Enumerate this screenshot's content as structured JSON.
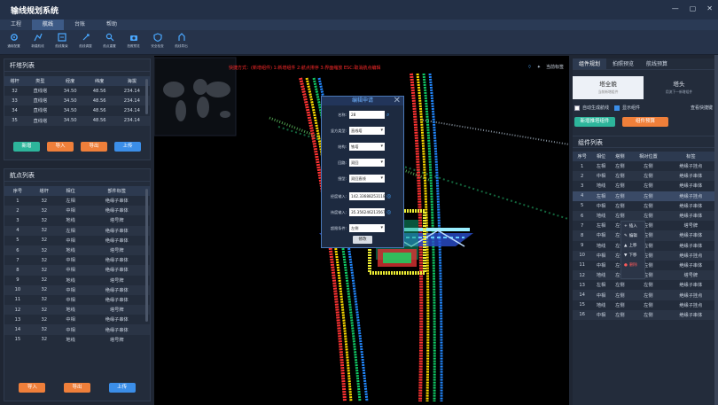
{
  "app": {
    "title": "输线规划系统"
  },
  "menu": [
    "工程",
    "航线",
    "台账",
    "帮助"
  ],
  "toolbar": [
    "通用配置",
    "新建航线",
    "航线集束",
    "航线调整",
    "航点重置",
    "拍照预览",
    "安全检查",
    "航线导出"
  ],
  "pole_panel": {
    "title": "杆塔列表",
    "columns": [
      "塔杆",
      "类型",
      "经度",
      "纬度",
      "海拔"
    ],
    "rows": [
      [
        "32",
        "直线塔",
        "34.50",
        "48.56",
        "234.14"
      ],
      [
        "33",
        "直线塔",
        "34.50",
        "48.56",
        "234.14"
      ],
      [
        "34",
        "直线塔",
        "34.50",
        "48.56",
        "234.14"
      ],
      [
        "35",
        "直线塔",
        "34.50",
        "48.56",
        "234.14"
      ]
    ],
    "buttons": [
      "新增",
      "导入",
      "导出",
      "上传"
    ]
  },
  "wp_panel": {
    "title": "航点列表",
    "columns": [
      "序号",
      "塔杆",
      "相位",
      "部件标签"
    ],
    "rows": [
      [
        "1",
        "32",
        "左相",
        "绝缘子串体"
      ],
      [
        "2",
        "32",
        "中相",
        "绝缘子串体"
      ],
      [
        "3",
        "32",
        "地线",
        "塔号牌"
      ],
      [
        "4",
        "32",
        "左相",
        "绝缘子串体"
      ],
      [
        "5",
        "32",
        "中相",
        "绝缘子串体"
      ],
      [
        "6",
        "32",
        "地线",
        "塔号牌"
      ],
      [
        "7",
        "32",
        "中相",
        "绝缘子串体"
      ],
      [
        "8",
        "32",
        "中相",
        "绝缘子串体"
      ],
      [
        "9",
        "32",
        "地线",
        "塔号牌"
      ],
      [
        "10",
        "32",
        "中相",
        "绝缘子串体"
      ],
      [
        "11",
        "32",
        "中相",
        "绝缘子串体"
      ],
      [
        "12",
        "32",
        "地线",
        "塔号牌"
      ],
      [
        "13",
        "32",
        "中相",
        "绝缘子串体"
      ],
      [
        "14",
        "32",
        "中相",
        "绝缘子串体"
      ],
      [
        "15",
        "32",
        "地线",
        "塔号牌"
      ]
    ],
    "buttons": [
      "导入",
      "导出",
      "上传"
    ]
  },
  "viewport": {
    "hint": "快捷方式：(新增组件) 1:新增组件 2:航点排序 3:界面缩放 ESC:取消航点编辑",
    "corner": "当前标签"
  },
  "dialog": {
    "title": "编辑申请",
    "fields": [
      {
        "label": "名称:",
        "value": "28",
        "type": "search"
      },
      {
        "label": "竖方类型:",
        "value": "直线塔",
        "type": "select"
      },
      {
        "label": "结构:",
        "value": "铁塔",
        "type": "select"
      },
      {
        "label": "回路:",
        "value": "双回",
        "type": "select"
      },
      {
        "label": "细型:",
        "value": "双回直线",
        "type": "select"
      },
      {
        "label": "经度输入:",
        "value": "142.336882531185",
        "type": "text"
      },
      {
        "label": "纬度输入:",
        "value": "35.356246213567",
        "type": "text"
      },
      {
        "label": "超限条件:",
        "value": "左侧",
        "type": "select"
      }
    ],
    "ok": "修改"
  },
  "right_panel": {
    "tabs": [
      "组件规划",
      "拍照预览",
      "航线预算"
    ],
    "segments": [
      {
        "title": "塔全貌",
        "sub": "当前新增组件"
      },
      {
        "title": "塔头",
        "sub": "用流下一新增组件"
      }
    ],
    "checks": [
      {
        "label": "自动生成航线",
        "on": false
      },
      {
        "label": "显示组件",
        "on": true
      }
    ],
    "shortcut": "查看快捷键",
    "buttons": [
      "新增推塔组件",
      "组件预算"
    ],
    "list_title": "组件列表",
    "columns": [
      "序号",
      "相位",
      "塔侧",
      "相对位置",
      "标签"
    ],
    "rows": [
      [
        "1",
        "左相",
        "左侧",
        "左侧",
        "绝缘子挂点"
      ],
      [
        "2",
        "中相",
        "左侧",
        "左侧",
        "绝缘子串体"
      ],
      [
        "3",
        "地线",
        "左侧",
        "左侧",
        "绝缘子串体"
      ],
      [
        "4",
        "左相",
        "左侧",
        "左侧",
        "绝缘子挂点"
      ],
      [
        "5",
        "中相",
        "左侧",
        "左侧",
        "绝缘子串体"
      ],
      [
        "6",
        "地线",
        "左侧",
        "左侧",
        "绝缘子串体"
      ],
      [
        "7",
        "左相",
        "左侧",
        "左侧",
        "塔号牌"
      ],
      [
        "8",
        "中相",
        "左侧",
        "左侧",
        "绝缘子串体"
      ],
      [
        "9",
        "地线",
        "左侧",
        "左侧",
        "绝缘子串体"
      ],
      [
        "10",
        "中相",
        "左侧",
        "左侧",
        "绝缘子挂点"
      ],
      [
        "11",
        "中相",
        "左侧",
        "左侧",
        "绝缘子串体"
      ],
      [
        "12",
        "地线",
        "左侧",
        "左侧",
        "塔号牌"
      ],
      [
        "13",
        "左相",
        "左侧",
        "左侧",
        "绝缘子串体"
      ],
      [
        "14",
        "中相",
        "左侧",
        "左侧",
        "绝缘子挂点"
      ],
      [
        "15",
        "地线",
        "左侧",
        "左侧",
        "绝缘子挂点"
      ],
      [
        "16",
        "中相",
        "左侧",
        "左侧",
        "绝缘子串体"
      ]
    ]
  },
  "context_menu": [
    "插入",
    "编辑",
    "上移",
    "下移",
    "删除"
  ]
}
